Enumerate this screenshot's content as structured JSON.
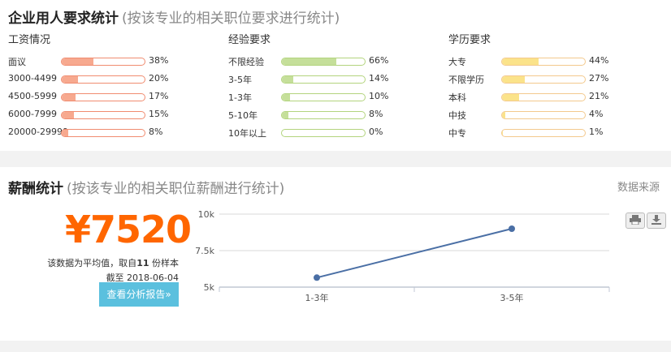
{
  "requirements": {
    "title": "企业用人要求统计",
    "subtitle": "(按该专业的相关职位要求进行统计)",
    "columns": [
      {
        "heading": "工资情况",
        "color_fill": "#f7a98f",
        "color_border": "#f08c70",
        "rows": [
          {
            "label": "面议",
            "value": 38,
            "pct": "38%"
          },
          {
            "label": "3000-4499",
            "value": 20,
            "pct": "20%"
          },
          {
            "label": "4500-5999",
            "value": 17,
            "pct": "17%"
          },
          {
            "label": "6000-7999",
            "value": 15,
            "pct": "15%"
          },
          {
            "label": "20000-29999",
            "value": 8,
            "pct": "8%"
          }
        ]
      },
      {
        "heading": "经验要求",
        "color_fill": "#c5df9a",
        "color_border": "#b3d47e",
        "rows": [
          {
            "label": "不限经验",
            "value": 66,
            "pct": "66%"
          },
          {
            "label": "3-5年",
            "value": 14,
            "pct": "14%"
          },
          {
            "label": "1-3年",
            "value": 10,
            "pct": "10%"
          },
          {
            "label": "5-10年",
            "value": 8,
            "pct": "8%"
          },
          {
            "label": "10年以上",
            "value": 0,
            "pct": "0%"
          }
        ]
      },
      {
        "heading": "学历要求",
        "color_fill": "#fbe38a",
        "color_border": "#f3c98d",
        "rows": [
          {
            "label": "大专",
            "value": 44,
            "pct": "44%"
          },
          {
            "label": "不限学历",
            "value": 27,
            "pct": "27%"
          },
          {
            "label": "本科",
            "value": 21,
            "pct": "21%"
          },
          {
            "label": "中技",
            "value": 4,
            "pct": "4%"
          },
          {
            "label": "中专",
            "value": 1,
            "pct": "1%"
          }
        ]
      }
    ]
  },
  "salary": {
    "title": "薪酬统计",
    "subtitle": "(按该专业的相关职位薪酬进行统计)",
    "data_source": "数据来源",
    "amount": "¥7520",
    "note_prefix": "该数据为平均值，取自",
    "sample_count": "11",
    "note_suffix": " 份样本",
    "date_line": "截至 2018-06-04",
    "report_button": "查看分析报告»",
    "print_icon": "print-icon",
    "download_icon": "download-icon"
  },
  "chart_data": {
    "type": "line",
    "categories": [
      "1-3年",
      "3-5年"
    ],
    "series": [
      {
        "values": [
          5650,
          9000
        ]
      }
    ],
    "ylim": [
      5000,
      10000
    ],
    "yticks": [
      {
        "v": 10000,
        "label": "10k"
      },
      {
        "v": 7500,
        "label": "7.5k"
      },
      {
        "v": 5000,
        "label": "5k"
      }
    ],
    "title": "",
    "xlabel": "",
    "ylabel": "",
    "line_color": "#4a6fa5",
    "grid": true
  }
}
